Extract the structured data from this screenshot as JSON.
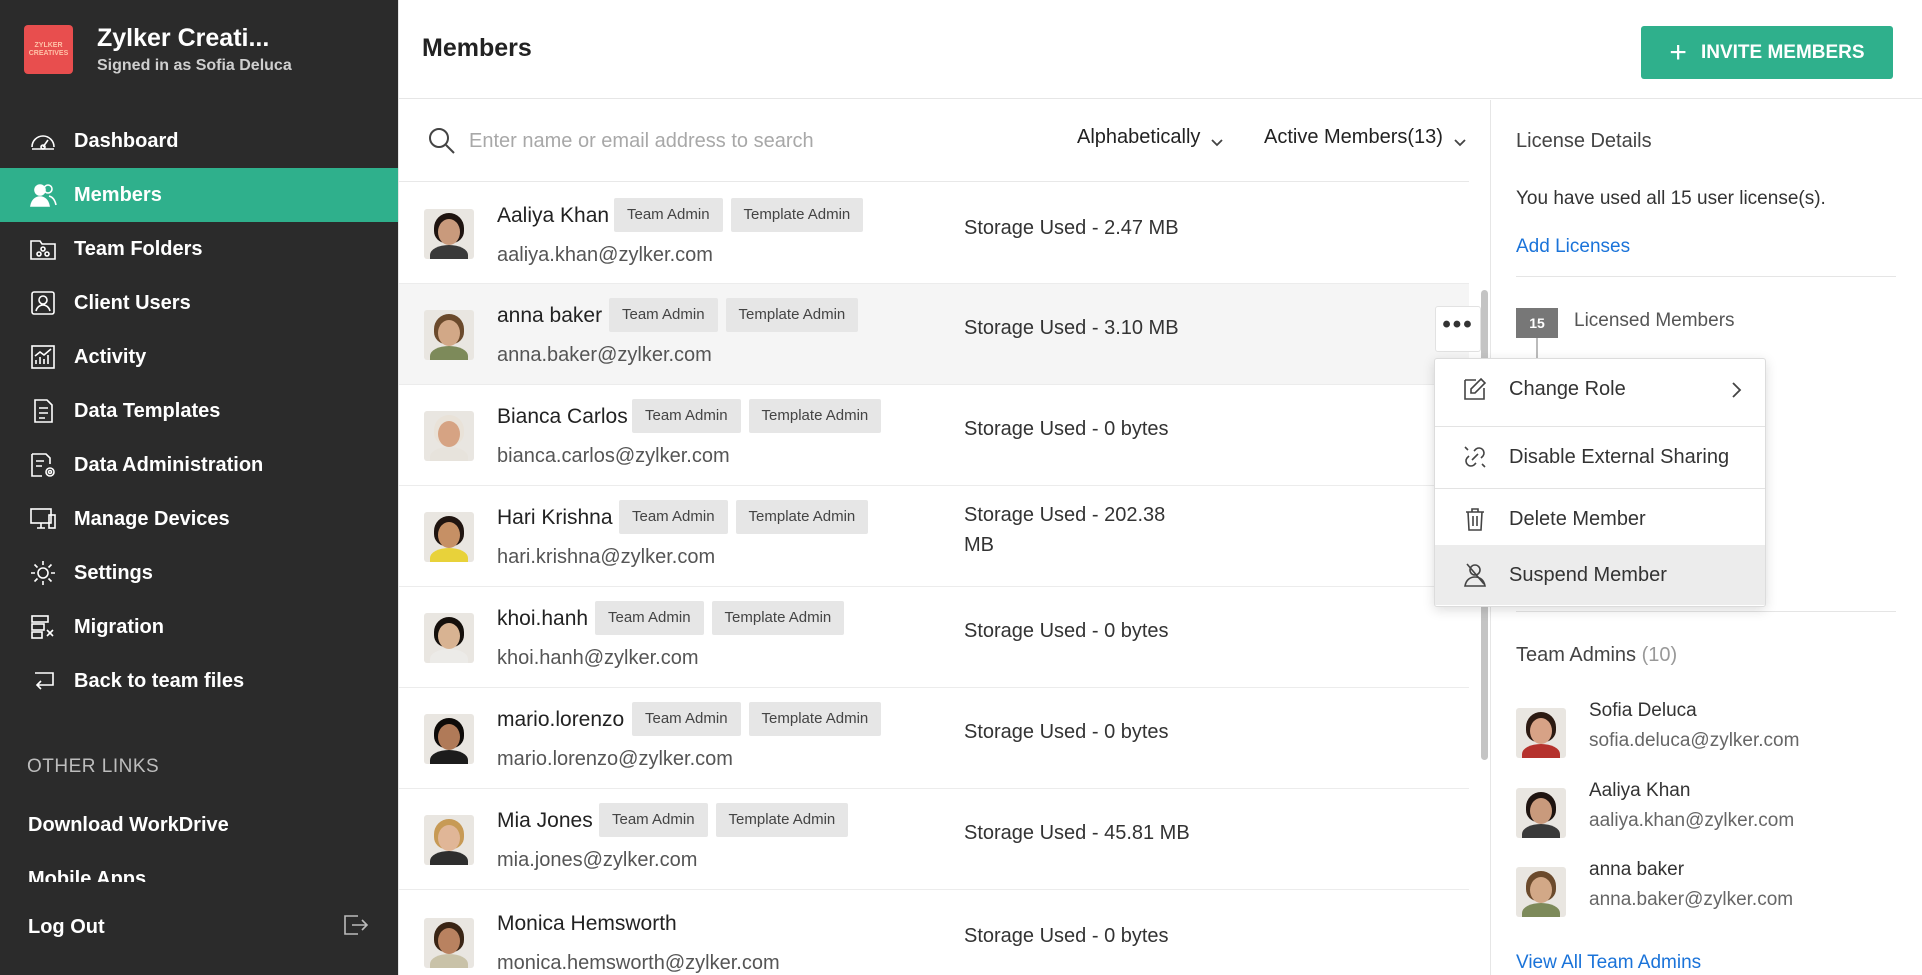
{
  "org": {
    "name": "Zylker Creati...",
    "signed_in_as": "Signed in as Sofia Deluca",
    "logo_text": "ZYLKER CREATIVES"
  },
  "sidebar": {
    "items": [
      {
        "label": "Dashboard",
        "icon": "dashboard-icon"
      },
      {
        "label": "Members",
        "icon": "members-icon",
        "active": true
      },
      {
        "label": "Team Folders",
        "icon": "team-folders-icon"
      },
      {
        "label": "Client Users",
        "icon": "client-users-icon"
      },
      {
        "label": "Activity",
        "icon": "activity-icon"
      },
      {
        "label": "Data Templates",
        "icon": "data-templates-icon"
      },
      {
        "label": "Data Administration",
        "icon": "data-administration-icon"
      },
      {
        "label": "Manage Devices",
        "icon": "manage-devices-icon"
      },
      {
        "label": "Settings",
        "icon": "settings-icon"
      },
      {
        "label": "Migration",
        "icon": "migration-icon"
      },
      {
        "label": "Back to team files",
        "icon": "back-icon"
      }
    ],
    "other_links_heading": "OTHER LINKS",
    "download_label": "Download WorkDrive",
    "mobile_label": "Mobile Apps",
    "logout_label": "Log Out"
  },
  "header": {
    "title": "Members",
    "invite_label": "INVITE MEMBERS"
  },
  "filters": {
    "search_placeholder": "Enter name or email address to search",
    "sort_label": "Alphabetically",
    "status_label": "Active Members(13)"
  },
  "badges": {
    "team_admin": "Team Admin",
    "template_admin": "Template Admin"
  },
  "members": [
    {
      "name": "Aaliya Khan",
      "email": "aaliya.khan@zylker.com",
      "storage": "Storage Used - 2.47 MB",
      "skin": "#c99a7c",
      "hair": "#1f1410",
      "shirt": "#3a3a3a"
    },
    {
      "name": "anna baker",
      "email": "anna.baker@zylker.com",
      "storage": "Storage Used - 3.10 MB",
      "skin": "#d2a887",
      "hair": "#6b4a2c",
      "shirt": "#7d8a5a"
    },
    {
      "name": "Bianca Carlos",
      "email": "bianca.carlos@zylker.com",
      "storage": "Storage Used - 0 bytes",
      "skin": "#d6a383",
      "hair": "#e9e2d8",
      "shirt": "#e7e3dc"
    },
    {
      "name": "Hari Krishna",
      "email": "hari.krishna@zylker.com",
      "storage": "Storage Used - 202.38 MB",
      "skin": "#c69065",
      "hair": "#201510",
      "shirt": "#e8d23a"
    },
    {
      "name": "khoi.hanh",
      "email": "khoi.hanh@zylker.com",
      "storage": "Storage Used - 0 bytes",
      "skin": "#d8b392",
      "hair": "#15100c",
      "shirt": "#ecebe8"
    },
    {
      "name": "mario.lorenzo",
      "email": "mario.lorenzo@zylker.com",
      "storage": "Storage Used - 0 bytes",
      "skin": "#b07a58",
      "hair": "#0e0b09",
      "shirt": "#1c1c1c"
    },
    {
      "name": "Mia Jones",
      "email": "mia.jones@zylker.com",
      "storage": "Storage Used - 45.81 MB",
      "skin": "#e0b697",
      "hair": "#c79a55",
      "shirt": "#2e2e2e"
    },
    {
      "name": "Monica Hemsworth",
      "email": "monica.hemsworth@zylker.com",
      "storage": "Storage Used - 0 bytes",
      "skin": "#b98260",
      "hair": "#3a2515",
      "shirt": "#c9c2a8"
    }
  ],
  "context_menu": {
    "items": [
      {
        "label": "Change Role",
        "icon": "edit-icon"
      },
      {
        "label": "Disable External Sharing",
        "icon": "link-off-icon"
      },
      {
        "label": "Delete Member",
        "icon": "trash-icon"
      },
      {
        "label": "Suspend Member",
        "icon": "suspend-user-icon"
      }
    ]
  },
  "license": {
    "title": "License Details",
    "usage_text": "You have used all 15 user license(s).",
    "add_link": "Add Licenses",
    "count": "15",
    "count_label": "Licensed Members",
    "admins_title": "Team Admins",
    "admins_count": "(10)",
    "admins": [
      {
        "name": "Sofia Deluca",
        "email": "sofia.deluca@zylker.com",
        "skin": "#d7a286",
        "hair": "#2c1a12",
        "shirt": "#b5322d"
      },
      {
        "name": "Aaliya Khan",
        "email": "aaliya.khan@zylker.com",
        "skin": "#c99a7c",
        "hair": "#1f1410",
        "shirt": "#3a3a3a"
      },
      {
        "name": "anna baker",
        "email": "anna.baker@zylker.com",
        "skin": "#d2a887",
        "hair": "#6b4a2c",
        "shirt": "#7d8a5a"
      }
    ],
    "view_all": "View All Team Admins"
  },
  "colors": {
    "accent": "#2fb08c",
    "sidebar_bg": "#2b2b2b",
    "link": "#1a73d9"
  }
}
